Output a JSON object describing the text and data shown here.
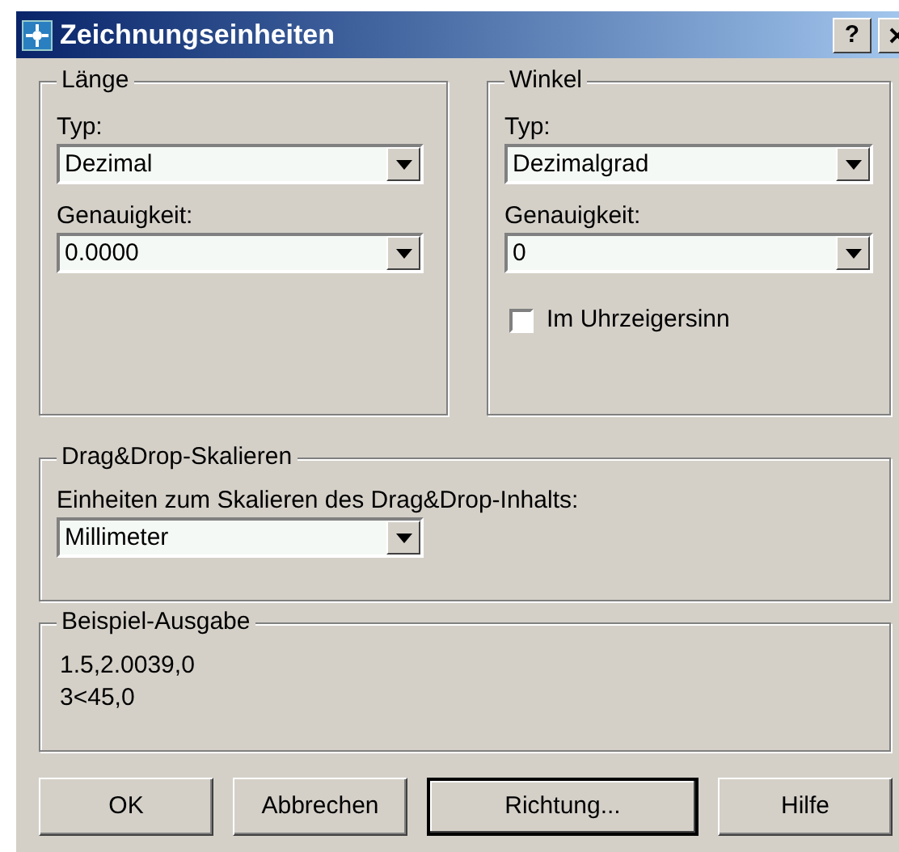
{
  "window": {
    "title": "Zeichnungseinheiten",
    "help_button": "?"
  },
  "laenge": {
    "title": "Länge",
    "type_label": "Typ:",
    "type_value": "Dezimal",
    "precision_label": "Genauigkeit:",
    "precision_value": "0.0000"
  },
  "winkel": {
    "title": "Winkel",
    "type_label": "Typ:",
    "type_value": "Dezimalgrad",
    "precision_label": "Genauigkeit:",
    "precision_value": "0",
    "clockwise": {
      "label": "Im Uhrzeigersinn",
      "checked": false
    }
  },
  "dragdrop": {
    "title": "Drag&Drop-Skalieren",
    "label": "Einheiten zum Skalieren des Drag&Drop-Inhalts:",
    "value": "Millimeter"
  },
  "sample": {
    "title": "Beispiel-Ausgabe",
    "lines": [
      "1.5,2.0039,0",
      "3<45,0"
    ]
  },
  "buttons": [
    {
      "label": "OK",
      "default": false
    },
    {
      "label": "Abbrechen",
      "default": false
    },
    {
      "label": "Richtung...",
      "default": true
    },
    {
      "label": "Hilfe",
      "default": false
    }
  ]
}
